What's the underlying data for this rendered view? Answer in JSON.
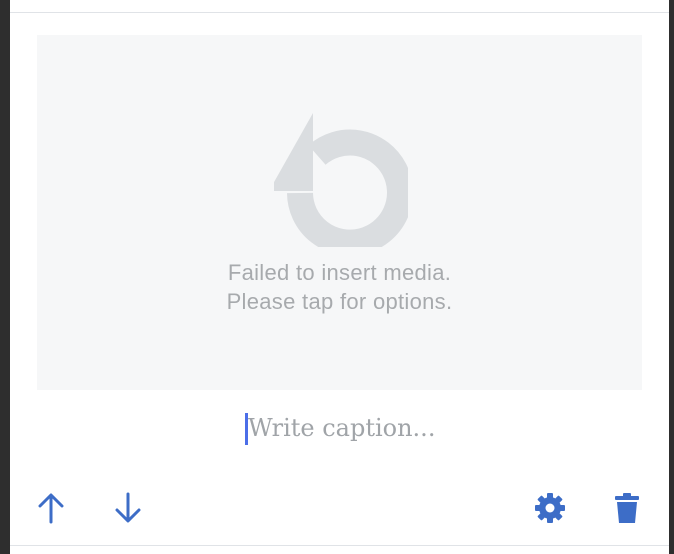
{
  "media": {
    "error_line1": "Failed to insert media.",
    "error_line2": "Please tap for options.",
    "icon": "retry-icon"
  },
  "caption": {
    "placeholder": "Write caption...",
    "value": ""
  },
  "toolbar": {
    "move_up_icon": "arrow-up-icon",
    "move_down_icon": "arrow-down-icon",
    "settings_icon": "gear-icon",
    "delete_icon": "trash-icon"
  },
  "colors": {
    "accent": "#3d6dc7",
    "icon_gray": "#dadde0",
    "cursor": "#4b6ee8"
  }
}
